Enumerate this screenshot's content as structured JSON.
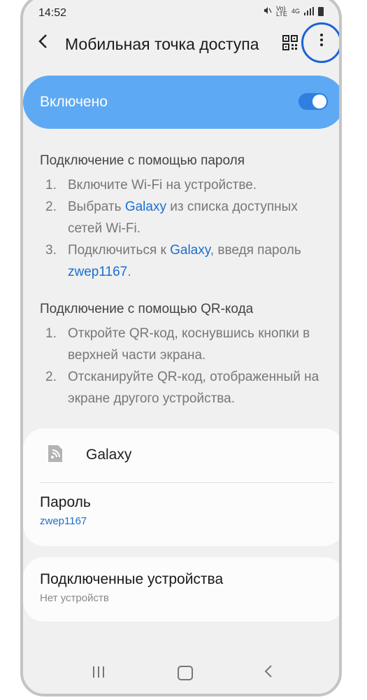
{
  "status_bar": {
    "time": "14:52",
    "volte": "Vo) LTE",
    "network": "4G"
  },
  "appbar": {
    "title": "Мобильная точка доступа"
  },
  "toggle": {
    "label": "Включено",
    "state": "on"
  },
  "password_section": {
    "heading": "Подключение с помощью пароля",
    "steps": [
      {
        "num": "1.",
        "text": "Включите Wi-Fi на устройстве."
      },
      {
        "num": "2.",
        "pre": "Выбрать ",
        "link": "Galaxy",
        "post": " из списка доступных сетей Wi-Fi."
      },
      {
        "num": "3.",
        "pre": "Подключиться к ",
        "link": "Galaxy",
        "post": ", введя пароль ",
        "link2": "zwep1167",
        "post2": "."
      }
    ]
  },
  "qr_section": {
    "heading": "Подключение с помощью QR-кода",
    "steps": [
      {
        "num": "1.",
        "text": "Откройте QR-код, коснувшись кнопки в верхней части экрана."
      },
      {
        "num": "2.",
        "text": "Отсканируйте QR-код, отображенный на экране другого устройства."
      }
    ]
  },
  "network_card": {
    "name": "Galaxy",
    "password_label": "Пароль",
    "password_value": "zwep1167"
  },
  "devices_card": {
    "title": "Подключенные устройства",
    "subtitle": "Нет устройств"
  },
  "colors": {
    "accent": "#5ea9f3",
    "link": "#1a6fd0",
    "highlight_ring": "#1c63d6"
  }
}
